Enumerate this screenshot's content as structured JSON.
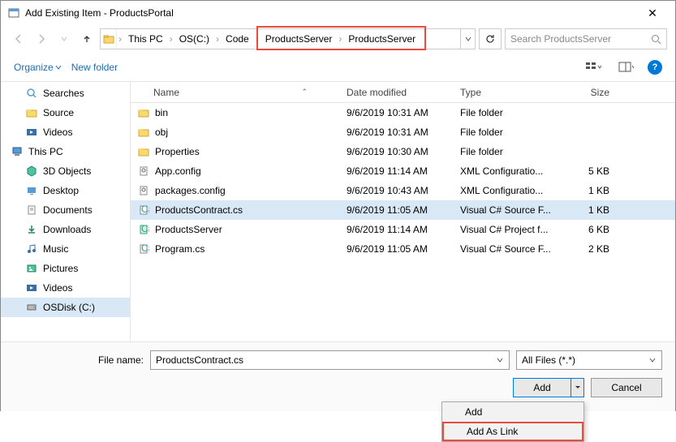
{
  "window": {
    "title": "Add Existing Item - ProductsPortal"
  },
  "breadcrumb": {
    "items": [
      "This PC",
      "OS(C:)",
      "Code",
      "ProductsServer",
      "ProductsServer"
    ],
    "highlight_start": 3,
    "highlight_end": 4
  },
  "search": {
    "placeholder": "Search ProductsServer"
  },
  "toolbar": {
    "organize": "Organize",
    "newfolder": "New folder"
  },
  "sidebar": {
    "items": [
      {
        "label": "Searches",
        "icon": "search",
        "indent": true
      },
      {
        "label": "Source",
        "icon": "folder",
        "indent": true
      },
      {
        "label": "Videos",
        "icon": "videos",
        "indent": true
      },
      {
        "label": "This PC",
        "icon": "pc",
        "indent": false
      },
      {
        "label": "3D Objects",
        "icon": "3d",
        "indent": true
      },
      {
        "label": "Desktop",
        "icon": "desktop",
        "indent": true
      },
      {
        "label": "Documents",
        "icon": "docs",
        "indent": true
      },
      {
        "label": "Downloads",
        "icon": "down",
        "indent": true
      },
      {
        "label": "Music",
        "icon": "music",
        "indent": true
      },
      {
        "label": "Pictures",
        "icon": "pics",
        "indent": true
      },
      {
        "label": "Videos",
        "icon": "videos",
        "indent": true
      },
      {
        "label": "OSDisk (C:)",
        "icon": "disk",
        "indent": true,
        "selected": true
      }
    ]
  },
  "columns": {
    "name": "Name",
    "date": "Date modified",
    "type": "Type",
    "size": "Size"
  },
  "files": [
    {
      "name": "bin",
      "date": "9/6/2019 10:31 AM",
      "type": "File folder",
      "size": "",
      "icon": "folder"
    },
    {
      "name": "obj",
      "date": "9/6/2019 10:31 AM",
      "type": "File folder",
      "size": "",
      "icon": "folder"
    },
    {
      "name": "Properties",
      "date": "9/6/2019 10:30 AM",
      "type": "File folder",
      "size": "",
      "icon": "folder"
    },
    {
      "name": "App.config",
      "date": "9/6/2019 11:14 AM",
      "type": "XML Configuratio...",
      "size": "5 KB",
      "icon": "config"
    },
    {
      "name": "packages.config",
      "date": "9/6/2019 10:43 AM",
      "type": "XML Configuratio...",
      "size": "1 KB",
      "icon": "config"
    },
    {
      "name": "ProductsContract.cs",
      "date": "9/6/2019 11:05 AM",
      "type": "Visual C# Source F...",
      "size": "1 KB",
      "icon": "cs",
      "selected": true
    },
    {
      "name": "ProductsServer",
      "date": "9/6/2019 11:14 AM",
      "type": "Visual C# Project f...",
      "size": "6 KB",
      "icon": "csproj"
    },
    {
      "name": "Program.cs",
      "date": "9/6/2019 11:05 AM",
      "type": "Visual C# Source F...",
      "size": "2 KB",
      "icon": "cs"
    }
  ],
  "footer": {
    "filename_label": "File name:",
    "filename_value": "ProductsContract.cs",
    "filter": "All Files (*.*)",
    "add": "Add",
    "cancel": "Cancel"
  },
  "dropdown": {
    "items": [
      {
        "label": "Add",
        "highlight": false
      },
      {
        "label": "Add As Link",
        "highlight": true
      }
    ]
  }
}
